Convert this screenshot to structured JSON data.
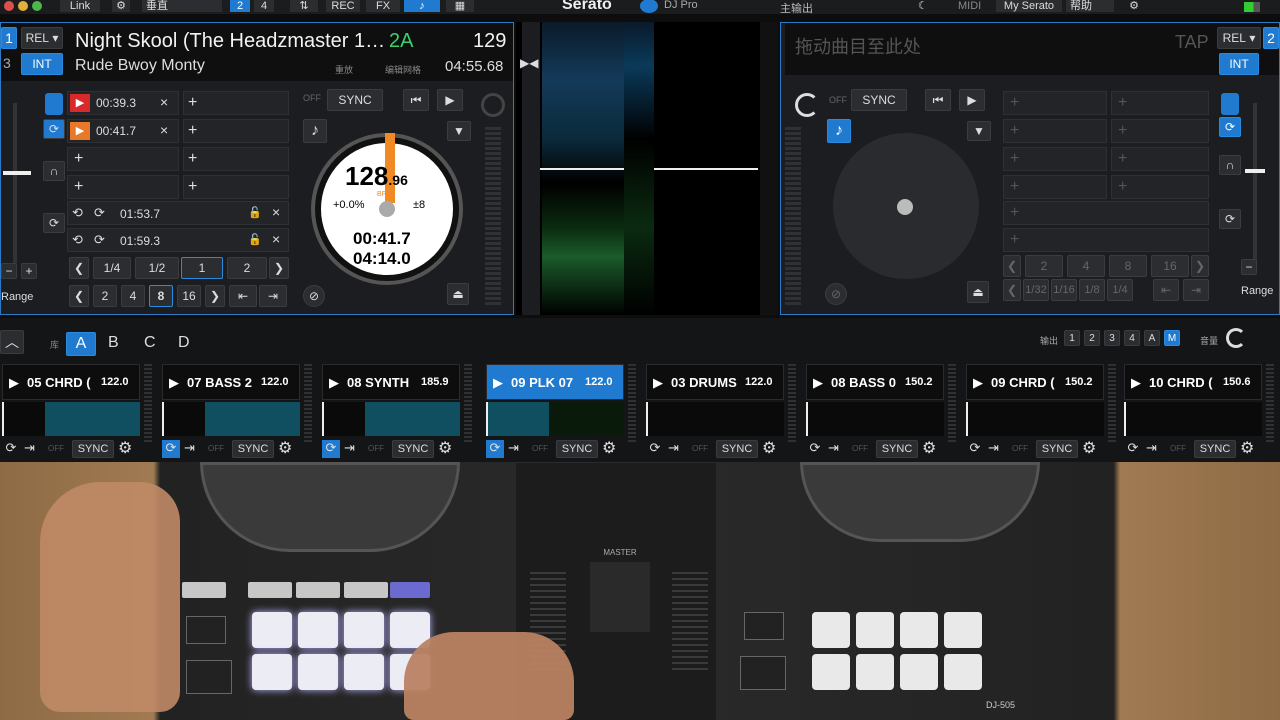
{
  "topbar": {
    "link": "Link",
    "layout": "垂直",
    "deck_count_a": "2",
    "deck_count_b": "4",
    "rec": "REC",
    "fx": "FX",
    "app": "Serato",
    "app_sub": "DJ Pro",
    "output": "主输出",
    "midi": "MIDI",
    "my_serato": "My Serato",
    "help": "帮助"
  },
  "left_deck": {
    "deck_num_top": "1",
    "deck_num_bottom": "3",
    "rel": "REL",
    "int": "INT",
    "title": "Night Skool (The Headzmaster 1…",
    "key": "2A",
    "bpm": "129",
    "artist": "Rude Bwoy Monty",
    "misc1": "重放",
    "misc2": "编辑网格",
    "remaining": "04:55.68",
    "cues": [
      {
        "time": "00:39.3",
        "color": "#d82a2a"
      },
      {
        "time": "00:41.7",
        "color": "#e8782a"
      }
    ],
    "loops": [
      {
        "time": "01:53.7"
      },
      {
        "time": "01:59.3"
      }
    ],
    "sync": "SYNC",
    "off": "OFF",
    "loop_fracs": [
      "1/4",
      "1/2",
      "1",
      "2"
    ],
    "loop_beats": [
      "2",
      "4",
      "8",
      "16"
    ],
    "platter": {
      "bpm_int": "128",
      "bpm_dec": ".96",
      "bpm_label": "BPM",
      "pitch": "+0.0%",
      "range": "±8",
      "elapsed": "00:41.7",
      "total": "04:14.0"
    },
    "range_label": "Range"
  },
  "right_deck": {
    "placeholder": "拖动曲目至此处",
    "tap": "TAP",
    "rel": "REL",
    "int": "INT",
    "sync": "SYNC",
    "off": "OFF",
    "loop_fracs": [
      "1/32",
      "1/16",
      "1/8",
      "1/4"
    ],
    "loop_beats": [
      "2",
      "4",
      "8",
      "16"
    ],
    "range_label": "Range"
  },
  "remix": {
    "label_lib": "库",
    "tabs": [
      "A",
      "B",
      "C",
      "D"
    ],
    "out_label": "输出",
    "outputs": [
      "1",
      "2",
      "3",
      "4",
      "A",
      "M"
    ],
    "vol_label": "音量",
    "slots": [
      {
        "name": "05 CHRD (",
        "bpm": "122.0",
        "active": false
      },
      {
        "name": "07 BASS 2",
        "bpm": "122.0",
        "active": false
      },
      {
        "name": "08 SYNTH",
        "bpm": "185.9",
        "active": false
      },
      {
        "name": "09 PLK 07",
        "bpm": "122.0",
        "active": true
      },
      {
        "name": "03 DRUMS",
        "bpm": "122.0",
        "active": false
      },
      {
        "name": "08 BASS 0",
        "bpm": "150.2",
        "active": false
      },
      {
        "name": "09 CHRD (",
        "bpm": "150.2",
        "active": false
      },
      {
        "name": "10 CHRD (",
        "bpm": "150.6",
        "active": false
      }
    ],
    "sync": "SYNC",
    "off": "OFF"
  },
  "hardware": {
    "model": "DJ-505",
    "master": "MASTER"
  }
}
